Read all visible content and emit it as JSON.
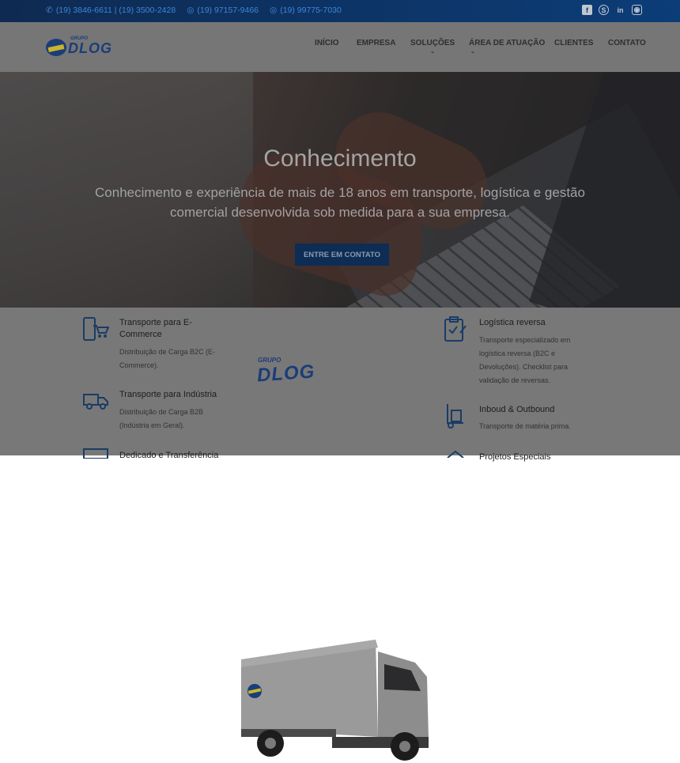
{
  "topbar": {
    "phones": [
      "(19) 3846-6611 | (19) 3500-2428",
      "(19) 97157-9466",
      "(19) 99775-7030"
    ],
    "social_icons": [
      "facebook-icon",
      "skype-icon",
      "linkedin-icon",
      "instagram-icon"
    ]
  },
  "logo": {
    "top": "GRUPO",
    "main": "DLOG"
  },
  "nav": {
    "items": [
      "INÍCIO",
      "EMPRESA",
      "SOLUÇÕES",
      "ÁREA DE ATUAÇÃO",
      "CLIENTES",
      "CONTATO"
    ]
  },
  "hero": {
    "title": "Conhecimento",
    "subtitle": "Conhecimento e experiência de mais de 18 anos em transporte, logística e gestão comercial desenvolvida sob medida para a sua empresa.",
    "cta": "ENTRE EM CONTATO"
  },
  "services": {
    "left": [
      {
        "title": "Transporte para E-Commerce",
        "desc": "Distribuição de Carga B2C (E-Commerce).",
        "icon": "mobile-cart-icon"
      },
      {
        "title": "Transporte para Indústria",
        "desc": "Distribuição de Carga B2B (Indústria em Geral).",
        "icon": "truck-icon"
      },
      {
        "title": "Dedicado e Transferência",
        "icon": "box-truck-icon"
      }
    ],
    "right": [
      {
        "title": "Logística reversa",
        "desc": "Transporte especializado em logística reversa (B2C e Devoluções). Checklist para validação de reversas.",
        "icon": "clipboard-check-icon"
      },
      {
        "title": "Inboud & Outbound",
        "desc": "Transporte de matéria prima.",
        "icon": "hand-truck-icon"
      },
      {
        "title": "Projetos Especiais",
        "icon": "house-icon"
      }
    ],
    "truck_logo": {
      "top": "GRUPO",
      "main": "DLOG"
    }
  },
  "colors": {
    "topbar": "#0c3d78",
    "accent": "#3d86d8",
    "brand": "#1b3d78",
    "cta": "#0d2d55"
  }
}
